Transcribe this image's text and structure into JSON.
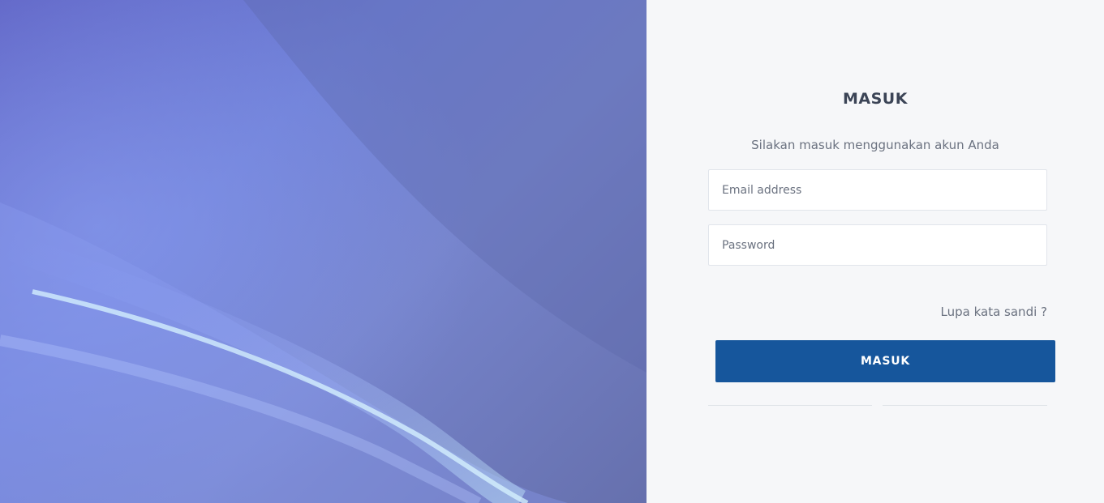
{
  "hero": {
    "image": "abstract-blue-light-wave"
  },
  "login": {
    "title": "MASUK",
    "subtitle": "Silakan masuk menggunakan akun Anda",
    "email_placeholder": "Email address",
    "email_value": "",
    "password_placeholder": "Password",
    "password_value": "",
    "forgot_label": "Lupa kata sandi ?",
    "submit_label": "MASUK"
  },
  "colors": {
    "primary_button": "#16569c",
    "panel_background": "#f6f7f9",
    "hero_base": "#6a75c9"
  }
}
